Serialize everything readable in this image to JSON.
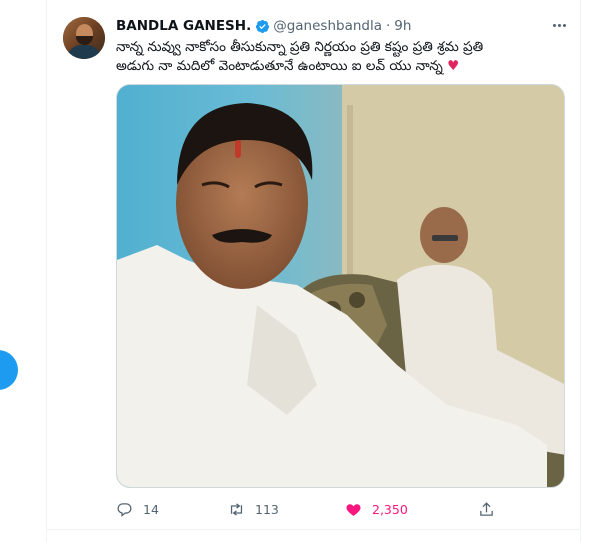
{
  "tweet": {
    "display_name": "BANDLA GANESH.",
    "handle": "@ganeshbandla",
    "separator": "·",
    "time": "9h",
    "text_line1": "నాన్న నువ్వు నాకోసం తీసుకున్నా ప్రతి నిర్ణయం ప్రతి కష్టం ప్రతి శ్రమ ప్రతి",
    "text_line2": "అడుగు నా మదిలో వెంటాడుతూనే ఉంటాయి ఐ లవ్ యు నాన్న",
    "text_emoji": "♥"
  },
  "actions": {
    "replies": "14",
    "retweets": "113",
    "likes": "2,350"
  },
  "icons": {
    "verified": "verified-badge-icon",
    "more": "more-horizontal-icon",
    "reply": "reply-icon",
    "retweet": "retweet-icon",
    "like": "heart-icon",
    "share": "share-icon"
  },
  "colors": {
    "accent": "#1d9bf0",
    "like": "#f91880",
    "muted": "#536471"
  }
}
